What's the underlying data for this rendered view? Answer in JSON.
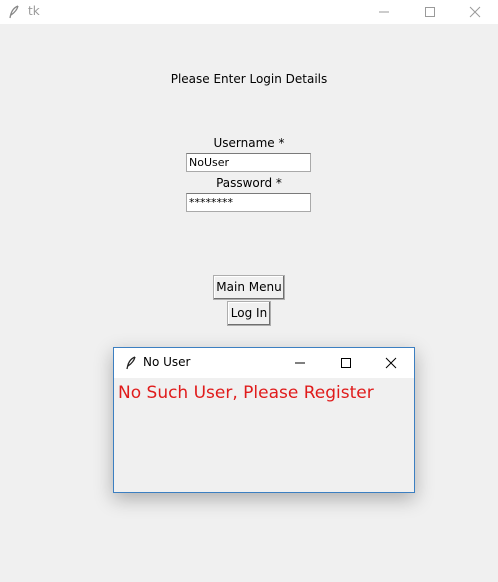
{
  "window": {
    "title": "tk",
    "icon": "feather-icon"
  },
  "form": {
    "heading": "Please Enter Login Details",
    "username_label": "Username *",
    "username_value": "NoUser",
    "password_label": "Password *",
    "password_value": "********"
  },
  "buttons": {
    "main_menu": "Main Menu",
    "log_in": "Log In"
  },
  "popup": {
    "title": "No User",
    "icon": "feather-icon",
    "message": "No Such User, Please Register",
    "message_color": "#e01b1b"
  }
}
